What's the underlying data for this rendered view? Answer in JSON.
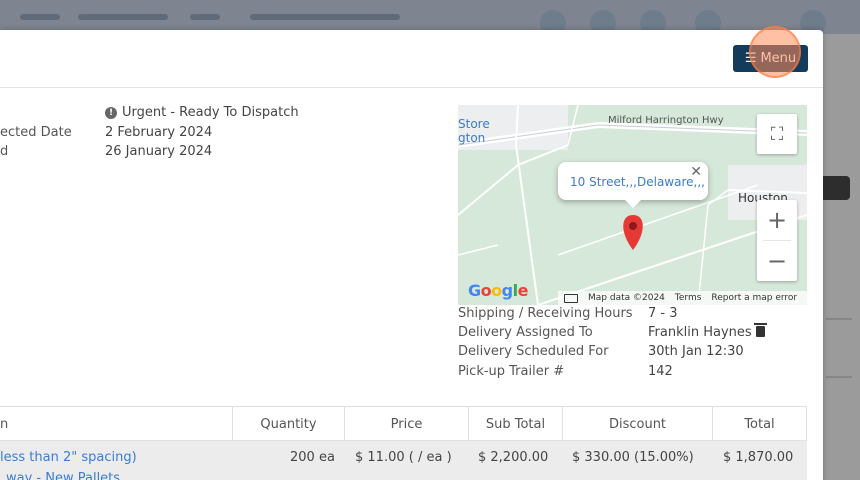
{
  "header": {
    "menu_label": "Menu"
  },
  "order": {
    "status": "Urgent - Ready To Dispatch",
    "fields": [
      {
        "label": "ected Date",
        "value": "2 February 2024"
      },
      {
        "label": "d",
        "value": "26 January 2024"
      }
    ]
  },
  "map": {
    "popup_text": "10 Street,,,Delaware,,,",
    "places": [
      "Store",
      "gton",
      "Houston"
    ],
    "road": "Milford Harrington Hwy",
    "footer": {
      "data": "Map data ©2024",
      "terms": "Terms",
      "report": "Report a map error"
    },
    "logo": "Google"
  },
  "delivery": [
    {
      "label": "Shipping / Receiving Hours",
      "value": "7 - 3"
    },
    {
      "label": "Delivery Assigned To",
      "value": "Franklin Haynes"
    },
    {
      "label": "Delivery Scheduled For",
      "value": "30th Jan 12:30"
    },
    {
      "label": "Pick-up Trailer #",
      "value": "142"
    }
  ],
  "table": {
    "headers": [
      "n",
      "Quantity",
      "Price",
      "Sub Total",
      "Discount",
      "Total"
    ],
    "row": {
      "item_line1": "less than 2\" spacing)",
      "item_line2": "way - New Pallets",
      "quantity": "200 ea",
      "price": "$ 11.00 ( / ea )",
      "subtotal": "$ 2,200.00",
      "discount": "$ 330.00 (15.00%)",
      "total": "$ 1,870.00"
    }
  },
  "colors": {
    "menu_bg": "#133b5c",
    "link": "#3a7bd5",
    "map_bg": "#d9eadd"
  }
}
